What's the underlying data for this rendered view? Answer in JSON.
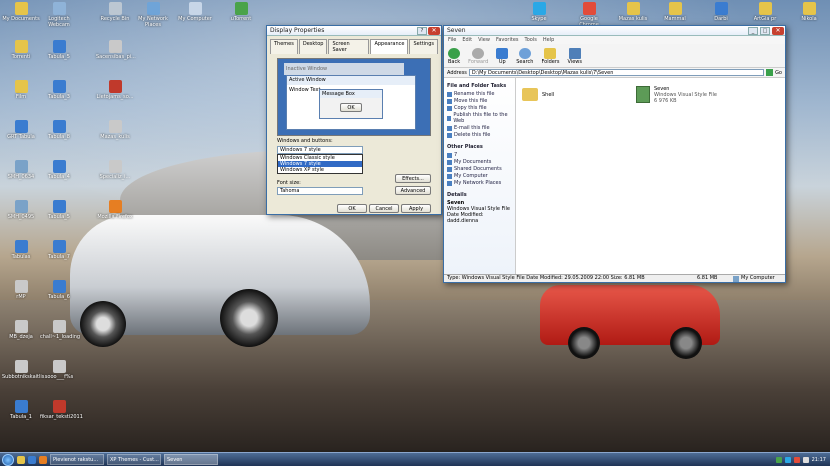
{
  "desktop_icons": [
    {
      "label": "My Documents",
      "color": "#e5c44a"
    },
    {
      "label": "Logitech Webcam",
      "color": "#8fb3d8"
    },
    {
      "label": "Recycle Bin",
      "color": "#bcc7d2"
    },
    {
      "label": "My Network Places",
      "color": "#6fa4d8"
    },
    {
      "label": "My Computer",
      "color": "#c7d6e8"
    },
    {
      "label": "uTorrent",
      "color": "#4aa34a"
    },
    {
      "label": "Skype",
      "color": "#2aa8e6"
    },
    {
      "label": "Google Chrome",
      "color": "#e24c3a"
    },
    {
      "label": "Mazas kulis",
      "color": "#e5c44a"
    },
    {
      "label": "Mammal",
      "color": "#e5c44a"
    },
    {
      "label": "Darbi",
      "color": "#3a7cd0"
    },
    {
      "label": "ArtGia pr",
      "color": "#e5c44a"
    },
    {
      "label": "Nikola",
      "color": "#e5c44a"
    },
    {
      "label": "Torrenti",
      "color": "#e5c44a"
    },
    {
      "label": "Tabula_5",
      "color": "#3a7cd0"
    },
    {
      "label": "Sacensibas_pi...",
      "color": "#c9c9c9"
    },
    {
      "label": "Film",
      "color": "#e5c44a"
    },
    {
      "label": "Tabula_3",
      "color": "#3a7cd0"
    },
    {
      "label": "Lietojams_so...",
      "color": "#c0392b"
    },
    {
      "label": "GRT Tabula",
      "color": "#3a7cd0"
    },
    {
      "label": "Tabula_8",
      "color": "#3a7cd0"
    },
    {
      "label": "Mazas_kulis",
      "color": "#c9c9c9"
    },
    {
      "label": "SMH_0634",
      "color": "#7aa2c8"
    },
    {
      "label": "Tabula_4",
      "color": "#3a7cd0"
    },
    {
      "label": "Specializ_i...",
      "color": "#c9c9c9"
    },
    {
      "label": "SMH_0495",
      "color": "#7aa2c8"
    },
    {
      "label": "Tabula_5",
      "color": "#3a7cd0"
    },
    {
      "label": "Mozilla Firefox",
      "color": "#e67e22"
    },
    {
      "label": "Tabulas",
      "color": "#3a7cd0"
    },
    {
      "label": "Tabula_7",
      "color": "#3a7cd0"
    },
    {
      "label": "rMP",
      "color": "#c9c9c9"
    },
    {
      "label": "Tabula_6",
      "color": "#3a7cd0"
    },
    {
      "label": "MB_dzeja",
      "color": "#c9c9c9"
    },
    {
      "label": "chall~1_loading",
      "color": "#c9c9c9"
    },
    {
      "label": "Subbotnikskaitlis...",
      "color": "#c9c9c9"
    },
    {
      "label": "sooo___f%s",
      "color": "#c9c9c9"
    },
    {
      "label": "Tabula_1",
      "color": "#3a7cd0"
    },
    {
      "label": "fiksar_teksti2011",
      "color": "#c0392b"
    }
  ],
  "display_properties": {
    "title": "Display Properties",
    "tabs": [
      "Themes",
      "Desktop",
      "Screen Saver",
      "Appearance",
      "Settings"
    ],
    "active_tab": "Appearance",
    "preview": {
      "inactive": "Inactive Window",
      "active": "Active Window",
      "window_text": "Window Text",
      "message_box": "Message Box",
      "ok": "OK"
    },
    "windows_buttons_label": "Windows and buttons:",
    "windows_buttons_value": "Windows 7 style",
    "style_options": [
      "Windows Classic style",
      "Windows 7 style",
      "Windows XP style"
    ],
    "font_size_label": "Font size:",
    "font_size_value": "Tahoma",
    "effects": "Effects...",
    "advanced": "Advanced",
    "ok": "OK",
    "cancel": "Cancel",
    "apply": "Apply"
  },
  "explorer": {
    "title": "Seven",
    "menu": [
      "File",
      "Edit",
      "View",
      "Favorites",
      "Tools",
      "Help"
    ],
    "toolbar": [
      "Back",
      "Forward",
      "Up",
      "Search",
      "Folders",
      "Views"
    ],
    "address_label": "Address",
    "address": "D:\\My Documents\\Desktop\\Desktop\\Mazas kulis\\7\\Seven",
    "go": "Go",
    "file_tasks_title": "File and Folder Tasks",
    "file_tasks": [
      "Rename this file",
      "Move this file",
      "Copy this file",
      "Publish this file to the Web",
      "E-mail this file",
      "Delete this file"
    ],
    "other_places_title": "Other Places",
    "other_places": [
      "7",
      "My Documents",
      "Shared Documents",
      "My Computer",
      "My Network Places"
    ],
    "details_title": "Details",
    "details_name": "Seven",
    "details_type": "Windows Visual Style File",
    "details_date": "Date Modified: dadd.dienna",
    "items": [
      {
        "name": "Shell",
        "type": "",
        "size": "",
        "color": "#e8c559"
      },
      {
        "name": "Seven",
        "type": "Windows Visual Style File",
        "size": "6 976 KB",
        "color": "#5d9b57"
      }
    ],
    "status_text": "Type: Windows Visual Style File Date Modified: 29.05.2009 22:00 Size: 6.81 MB",
    "status_size": "6.81 MB",
    "status_zone": "My Computer"
  },
  "taskbar": {
    "tasks": [
      "Pievienot rakstu...",
      "XP Themes - Cust...",
      "Seven"
    ],
    "clock": "21:17"
  }
}
